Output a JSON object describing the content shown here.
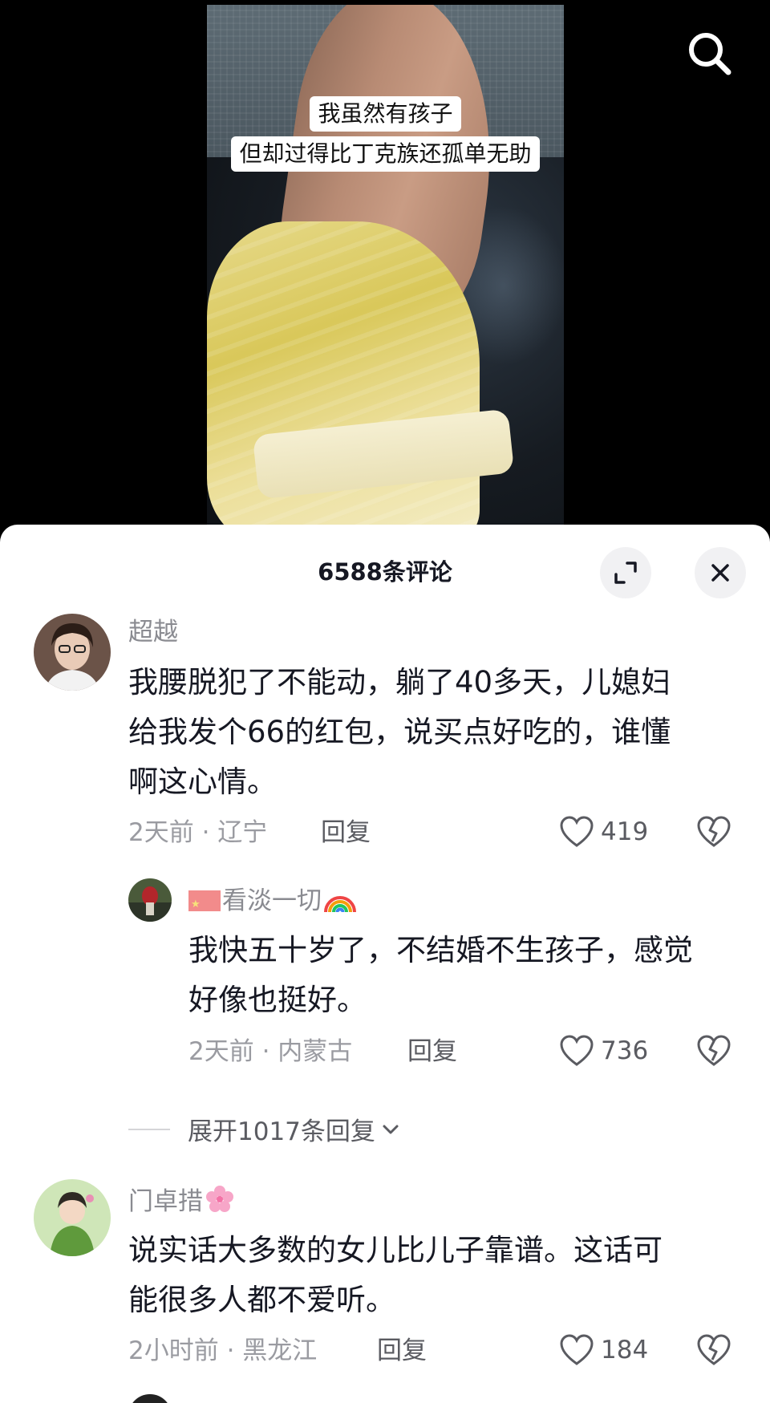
{
  "video": {
    "caption_line1": "我虽然有孩子",
    "caption_line2": "但却过得比丁克族还孤单无助",
    "search_icon": "search-icon"
  },
  "sheet": {
    "title": "6588条评论",
    "expand_icon": "expand-icon",
    "close_icon": "close-icon"
  },
  "comments": [
    {
      "username": "超越",
      "text_lines": [
        "我腰脱犯了不能动，躺了40多天，儿媳妇",
        "给我发个66的红包，说买点好吃的，谁懂",
        "啊这心情。"
      ],
      "meta": "2天前 · 辽宁",
      "reply_label": "回复",
      "likes": "419"
    },
    {
      "username": "看淡一切",
      "text_lines": [
        "我快五十岁了，不结婚不生孩子，感觉",
        "好像也挺好。"
      ],
      "meta": "2天前 · 内蒙古",
      "reply_label": "回复",
      "likes": "736"
    },
    {
      "username": "门卓措",
      "text_lines": [
        "说实话大多数的女儿比儿子靠谱。这话可",
        "能很多人都不爱听。"
      ],
      "meta": "2小时前 · 黑龙江",
      "reply_label": "回复",
      "likes": "184"
    }
  ],
  "expand_replies_label": "展开1017条回复",
  "colors": {
    "text": "#161823",
    "muted": "#8a8b91",
    "sheet_bg": "#ffffff"
  }
}
